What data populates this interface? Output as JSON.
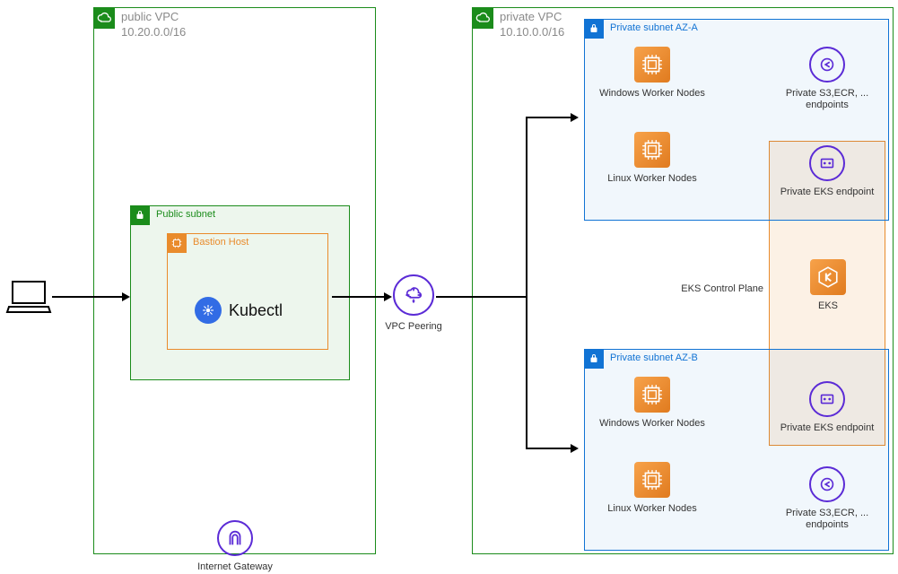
{
  "publicVPC": {
    "title": "public VPC",
    "cidr": "10.20.0.0/16",
    "publicSubnet": {
      "title": "Public subnet",
      "bastion": {
        "title": "Bastion Host",
        "kubectl": "Kubectl"
      }
    }
  },
  "privateVPC": {
    "title": "private VPC",
    "cidr": "10.10.0.0/16",
    "subnetA": {
      "title": "Private subnet AZ-A",
      "windows": "Windows Worker Nodes",
      "linux": "Linux Worker Nodes",
      "endpoints": "Private S3,ECR, ... endpoints",
      "eksEndpoint": "Private EKS endpoint"
    },
    "eksControlPlane": "EKS Control Plane",
    "eks": "EKS",
    "subnetB": {
      "title": "Private subnet AZ-B",
      "windows": "Windows Worker Nodes",
      "linux": "Linux Worker Nodes",
      "endpoints": "Private S3,ECR, ... endpoints",
      "eksEndpoint": "Private EKS endpoint"
    }
  },
  "vpcPeering": "VPC Peering",
  "internetGateway": "Internet Gateway"
}
